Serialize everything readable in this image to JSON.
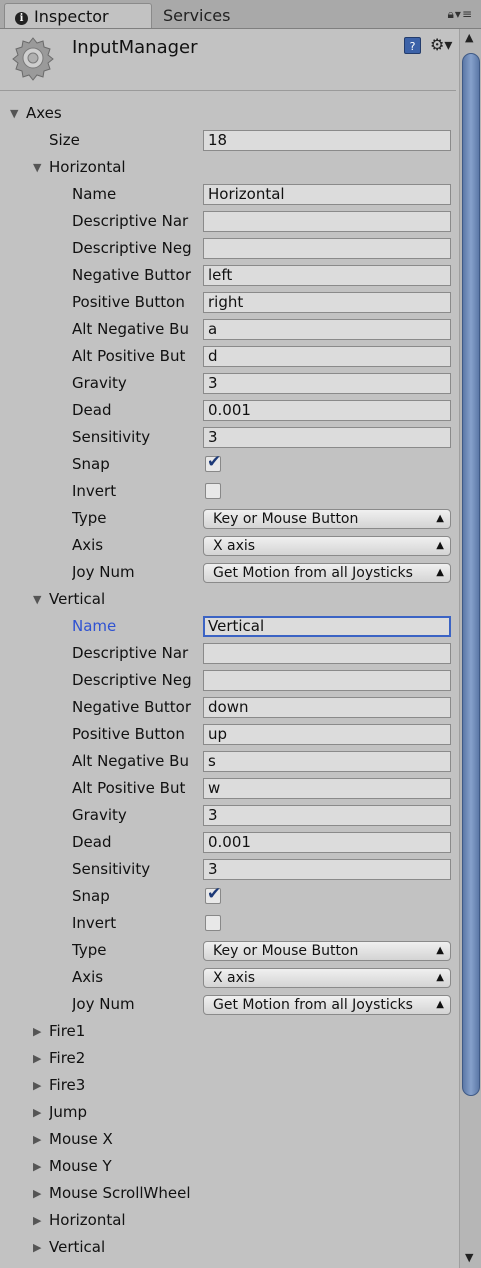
{
  "tabs": {
    "inspector": "Inspector",
    "services": "Services",
    "info_icon": "i"
  },
  "header": {
    "title": "InputManager",
    "help_icon": "?"
  },
  "axes": {
    "label": "Axes",
    "size_label": "Size",
    "size_value": "18",
    "horizontal": {
      "label": "Horizontal",
      "rows": {
        "name": {
          "label": "Name",
          "value": "Horizontal"
        },
        "desc_name": {
          "label": "Descriptive Nar",
          "value": ""
        },
        "desc_neg": {
          "label": "Descriptive Neg",
          "value": ""
        },
        "neg_button": {
          "label": "Negative Buttor",
          "value": "left"
        },
        "pos_button": {
          "label": "Positive Button",
          "value": "right"
        },
        "alt_neg": {
          "label": "Alt Negative Bu",
          "value": "a"
        },
        "alt_pos": {
          "label": "Alt Positive But",
          "value": "d"
        },
        "gravity": {
          "label": "Gravity",
          "value": "3"
        },
        "dead": {
          "label": "Dead",
          "value": "0.001"
        },
        "sensitivity": {
          "label": "Sensitivity",
          "value": "3"
        },
        "snap": {
          "label": "Snap",
          "checked": true
        },
        "invert": {
          "label": "Invert",
          "checked": false
        },
        "type": {
          "label": "Type",
          "value": "Key or Mouse Button"
        },
        "axis": {
          "label": "Axis",
          "value": "X axis"
        },
        "joy": {
          "label": "Joy Num",
          "value": "Get Motion from all Joysticks"
        }
      }
    },
    "vertical": {
      "label": "Vertical",
      "rows": {
        "name": {
          "label": "Name",
          "value": "Vertical"
        },
        "desc_name": {
          "label": "Descriptive Nar",
          "value": ""
        },
        "desc_neg": {
          "label": "Descriptive Neg",
          "value": ""
        },
        "neg_button": {
          "label": "Negative Buttor",
          "value": "down"
        },
        "pos_button": {
          "label": "Positive Button",
          "value": "up"
        },
        "alt_neg": {
          "label": "Alt Negative Bu",
          "value": "s"
        },
        "alt_pos": {
          "label": "Alt Positive But",
          "value": "w"
        },
        "gravity": {
          "label": "Gravity",
          "value": "3"
        },
        "dead": {
          "label": "Dead",
          "value": "0.001"
        },
        "sensitivity": {
          "label": "Sensitivity",
          "value": "3"
        },
        "snap": {
          "label": "Snap",
          "checked": true
        },
        "invert": {
          "label": "Invert",
          "checked": false
        },
        "type": {
          "label": "Type",
          "value": "Key or Mouse Button"
        },
        "axis": {
          "label": "Axis",
          "value": "X axis"
        },
        "joy": {
          "label": "Joy Num",
          "value": "Get Motion from all Joysticks"
        }
      }
    },
    "collapsed": [
      "Fire1",
      "Fire2",
      "Fire3",
      "Jump",
      "Mouse X",
      "Mouse Y",
      "Mouse ScrollWheel",
      "Horizontal",
      "Vertical"
    ]
  },
  "icons": {
    "tab_info": "info-icon",
    "lock": "lock-icon",
    "menu": "menu-icon",
    "component": "gear-icon",
    "help": "help-icon",
    "settings": "settings-gear-icon",
    "fold_open": "triangle-down-icon",
    "fold_closed": "triangle-right-icon",
    "checkmark": "checkmark-icon",
    "popup_arrows": "updown-arrows-icon"
  },
  "colors": {
    "focused_label": "#2f52d2",
    "scroll_thumb": "#7d98c4",
    "background": "#c2c2c2"
  }
}
